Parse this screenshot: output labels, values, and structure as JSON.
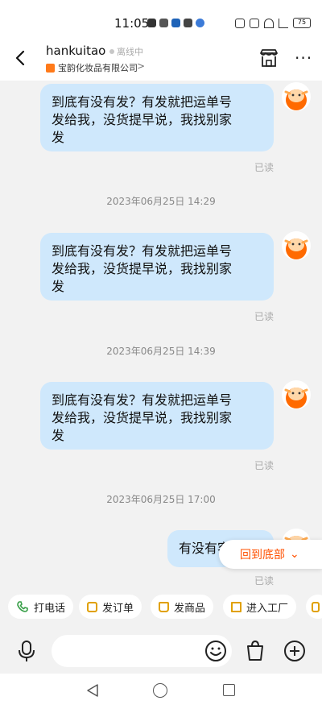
{
  "status_bar": {
    "time": "11:05",
    "battery": "75"
  },
  "header": {
    "user_name": "hankuitao",
    "online_status": "离线中",
    "shop_name": "宝韵化妆品有限公司",
    "shop_chevron": ">"
  },
  "messages": [
    {
      "lines": [
        "到底有没有发？有发就把运单号",
        "发给我，没货提早说，我找别家",
        "发"
      ],
      "read": "已读"
    },
    {
      "timestamp": "2023年06月25日 14:29"
    },
    {
      "lines": [
        "到底有没有发？有发就把运单号",
        "发给我，没货提早说，我找别家",
        "发"
      ],
      "read": "已读"
    },
    {
      "timestamp": "2023年06月25日 14:39"
    },
    {
      "lines": [
        "到底有没有发？有发就把运单号",
        "发给我，没货提早说，我找别家",
        "发"
      ],
      "read": "已读"
    },
    {
      "timestamp": "2023年06月25日 17:00"
    },
    {
      "lines": [
        "有没有客服？"
      ],
      "read": "已读"
    }
  ],
  "scroll_to_bottom": {
    "label": "回到底部",
    "chevron": "⌄"
  },
  "quick_actions": [
    {
      "label": "打电话",
      "icon": "phone-icon",
      "color": "#3aa04a"
    },
    {
      "label": "发订单",
      "icon": "order-icon",
      "color": "#e0a000"
    },
    {
      "label": "发商品",
      "icon": "bag-icon",
      "color": "#e0a000"
    },
    {
      "label": "进入工厂",
      "icon": "factory-icon",
      "color": "#e0a000"
    }
  ],
  "input": {
    "placeholder": ""
  },
  "colors": {
    "bubble": "#cfe8fc",
    "accent": "#ff5000",
    "shop_badge": "#ff7a1a"
  }
}
